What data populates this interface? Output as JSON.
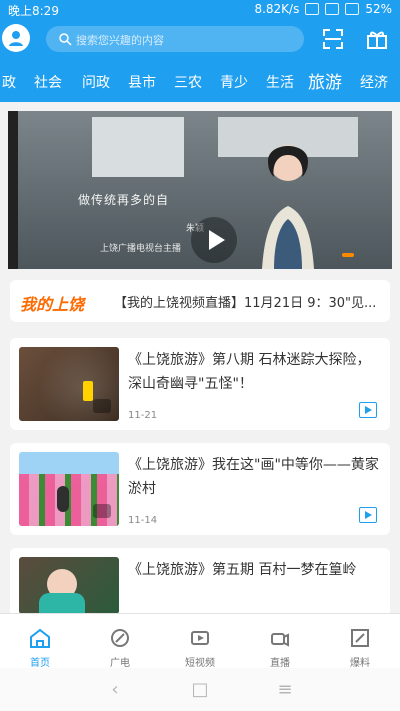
{
  "status": {
    "time": "晚上8:29",
    "speed": "8.82K/s",
    "battery": "52%"
  },
  "header": {
    "search_placeholder": "搜索您兴趣的内容"
  },
  "tabs": [
    "政",
    "社会",
    "问政",
    "县市",
    "三农",
    "青少",
    "生活",
    "旅游",
    "经济"
  ],
  "active_tab": "旅游",
  "banner": {
    "caption": "做传统再多的自",
    "subcaption": "上饶广播电视台主播",
    "name": "朱颖"
  },
  "ticker": {
    "logo": "我的上饶",
    "text": "【我的上饶视频直播】11月21日 9：30\"见..."
  },
  "cards": [
    {
      "title": "《上饶旅游》第八期 石林迷踪大探险，深山奇幽寻\"五怪\"！",
      "date": "11-21"
    },
    {
      "title": "《上饶旅游》我在这\"画\"中等你——黄家淤村",
      "date": "11-14"
    },
    {
      "title": "《上饶旅游》第五期 百村一梦在篁岭",
      "date": ""
    }
  ],
  "bottom_nav": [
    {
      "label": "首页"
    },
    {
      "label": "广电"
    },
    {
      "label": "短视频"
    },
    {
      "label": "直播"
    },
    {
      "label": "爆料"
    }
  ],
  "android_keys": [
    "‹",
    "□",
    "≡"
  ]
}
